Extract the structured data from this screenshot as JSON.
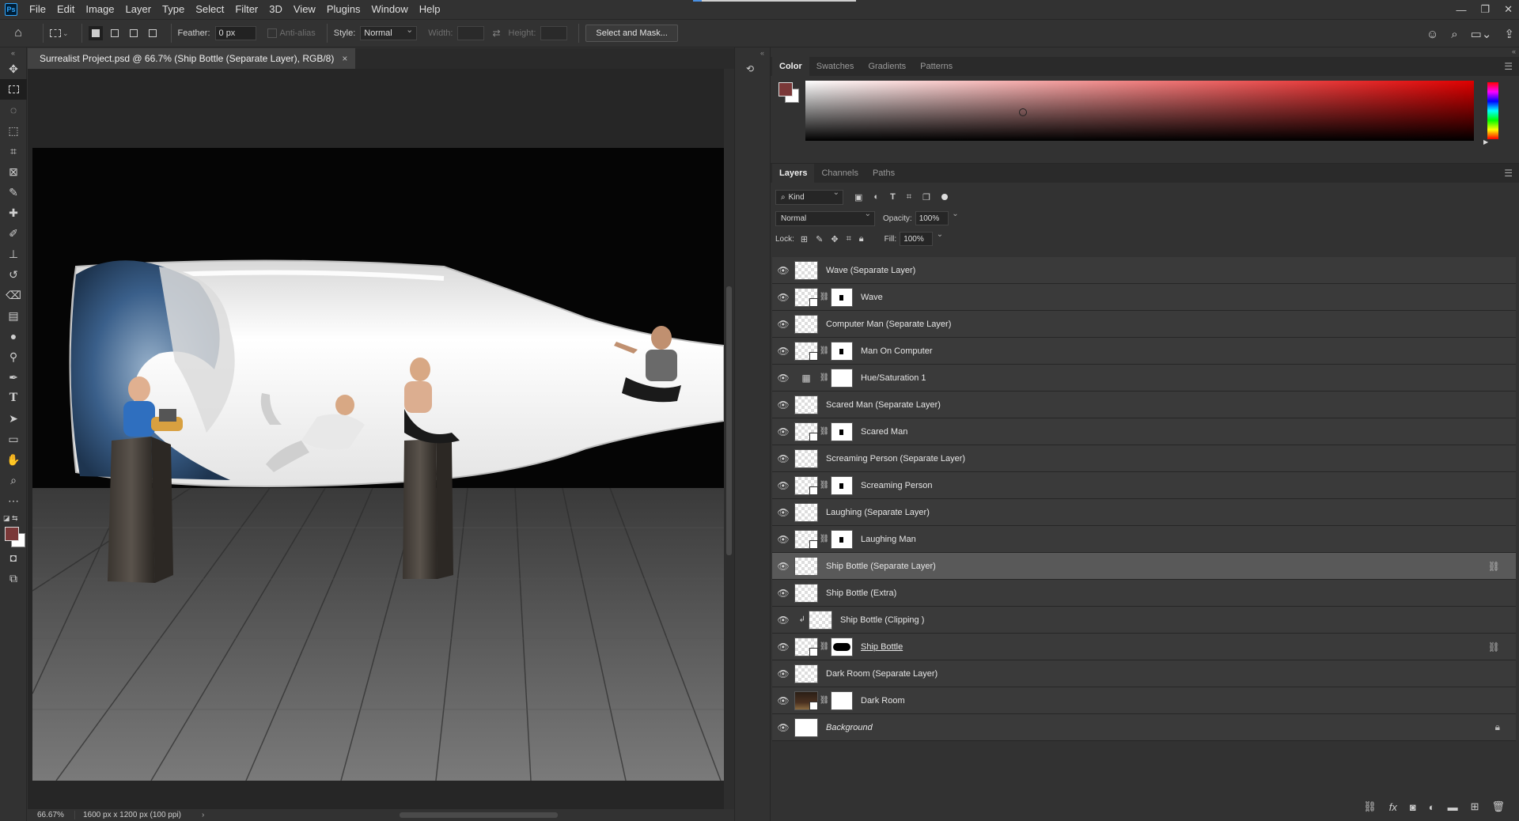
{
  "app": {
    "logo": "Ps",
    "menu": [
      "File",
      "Edit",
      "Image",
      "Layer",
      "Type",
      "Select",
      "Filter",
      "3D",
      "View",
      "Plugins",
      "Window",
      "Help"
    ]
  },
  "options": {
    "feather_label": "Feather:",
    "feather_value": "0 px",
    "antialias_label": "Anti-alias",
    "style_label": "Style:",
    "style_value": "Normal",
    "width_label": "Width:",
    "height_label": "Height:",
    "select_mask_label": "Select and Mask..."
  },
  "document": {
    "tab_title": "Surrealist Project.psd @ 66.7% (Ship Bottle (Separate Layer), RGB/8)",
    "close_glyph": "×"
  },
  "status": {
    "zoom": "66.67%",
    "info": "1600 px x 1200 px (100 ppi)",
    "arrow": "›"
  },
  "color_panel": {
    "tabs": [
      "Color",
      "Swatches",
      "Gradients",
      "Patterns"
    ],
    "active_tab": 0,
    "foreground": "#7a3838",
    "background": "#ffffff"
  },
  "layers_panel": {
    "tabs": [
      "Layers",
      "Channels",
      "Paths"
    ],
    "active_tab": 0,
    "kind_label": "Kind",
    "blend_mode": "Normal",
    "opacity_label": "Opacity:",
    "opacity_value": "100%",
    "lock_label": "Lock:",
    "fill_label": "Fill:",
    "fill_value": "100%",
    "layers": [
      {
        "name": "Wave (Separate Layer)",
        "type": "pixel"
      },
      {
        "name": "Wave",
        "type": "smart-masked"
      },
      {
        "name": "Computer Man (Separate Layer)",
        "type": "pixel"
      },
      {
        "name": "Man On Computer",
        "type": "smart-masked"
      },
      {
        "name": "Hue/Saturation 1",
        "type": "adjustment"
      },
      {
        "name": "Scared Man (Separate Layer)",
        "type": "pixel"
      },
      {
        "name": "Scared Man",
        "type": "smart-masked"
      },
      {
        "name": "Screaming Person (Separate Layer)",
        "type": "pixel"
      },
      {
        "name": "Screaming Person",
        "type": "smart-masked"
      },
      {
        "name": "Laughing (Separate Layer)",
        "type": "pixel"
      },
      {
        "name": "Laughing Man",
        "type": "smart-masked"
      },
      {
        "name": "Ship Bottle (Separate Layer)",
        "type": "pixel",
        "selected": true,
        "linked": true
      },
      {
        "name": "Ship Bottle (Extra)",
        "type": "pixel"
      },
      {
        "name": "Ship Bottle (Clipping )",
        "type": "clipped"
      },
      {
        "name": "Ship Bottle",
        "type": "smart-masked",
        "linked": true
      },
      {
        "name": "Dark Room (Separate Layer)",
        "type": "pixel"
      },
      {
        "name": "Dark Room",
        "type": "smart-masked-dark"
      },
      {
        "name": "Background",
        "type": "background",
        "locked": true
      }
    ]
  }
}
